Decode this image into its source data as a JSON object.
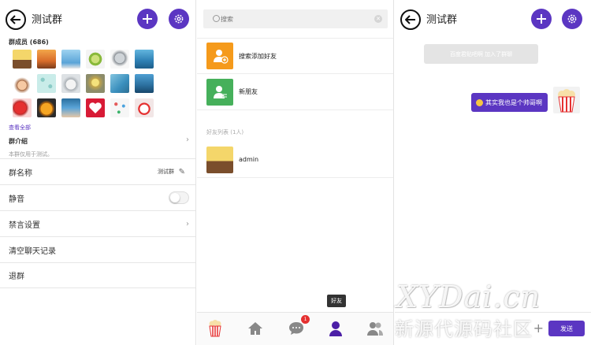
{
  "group_panel": {
    "title": "测试群",
    "members_title": "群成员 (686)",
    "see_all": "查看全部",
    "intro_title": "群介绍",
    "intro_text": "本群仅用于测试。",
    "rows": [
      {
        "label": "群名称",
        "value": "测试群"
      },
      {
        "label": "静音"
      },
      {
        "label": "禁言设置"
      },
      {
        "label": "清空聊天记录"
      },
      {
        "label": "退群"
      }
    ],
    "mute_on": false,
    "accent": "#5b36c2"
  },
  "contacts_panel": {
    "search": {
      "placeholder": "搜索"
    },
    "add_friend": "搜索添加好友",
    "new_friends": "新朋友",
    "friends_header": "好友列表 (1人)",
    "friend_name": "admin",
    "tooltip": "好友",
    "unread_badge": "1"
  },
  "chat_panel": {
    "title": "测试群",
    "system_message": "百度君贴吧啊 加入了群聊",
    "message": "其实我也是个帅哥啊",
    "send_label": "发送"
  },
  "watermark": {
    "line1": "XYDai.cn",
    "line2": "新源代源码社区"
  },
  "icons": {
    "back": "back-arrow-icon",
    "add": "plus-icon",
    "settings": "gear-icon",
    "edit": "pencil-icon",
    "search": "search-icon",
    "home": "home-icon",
    "chat": "chat-icon",
    "contact": "person-icon",
    "group": "group-icon"
  }
}
